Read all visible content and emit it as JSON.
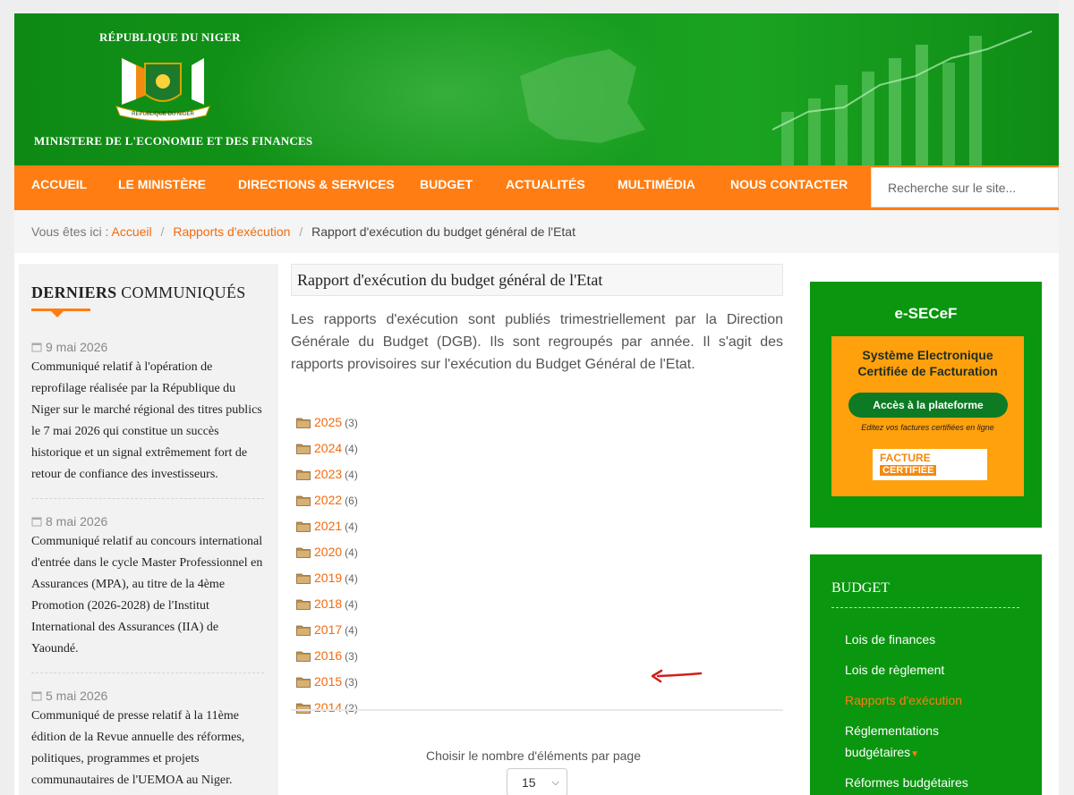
{
  "header": {
    "country": "RÉPUBLIQUE DU NIGER",
    "ministry": "MINISTERE DE L'ECONOMIE ET DES FINANCES",
    "emblem_text": "REPUBLIQUE DU NIGER"
  },
  "nav": {
    "items": [
      "ACCUEIL",
      "LE MINISTÈRE",
      "DIRECTIONS & SERVICES",
      "BUDGET",
      "ACTUALITÉS",
      "MULTIMÉDIA",
      "NOUS CONTACTER"
    ],
    "search_placeholder": "Recherche sur le site..."
  },
  "breadcrumb": {
    "prefix": "Vous êtes ici :",
    "home": "Accueil",
    "section": "Rapports d'exécution",
    "current": "Rapport d'exécution du budget général de l'Etat"
  },
  "communiques": {
    "title_bold": "DERNIERS",
    "title_rest": "COMMUNIQUÉS",
    "items": [
      {
        "date": "9 mai 2026",
        "text": "Communiqué relatif à l'opération de reprofilage réalisée par la République du Niger sur le marché régional des titres publics le 7 mai 2026 qui constitue un succès historique et un signal extrêmement fort de retour de confiance des investisseurs."
      },
      {
        "date": "8 mai 2026",
        "text": "Communiqué relatif au concours international d'entrée dans le cycle Master Professionnel en Assurances (MPA), au titre de la 4ème Promotion (2026-2028) de l'Institut International des Assurances (IIA) de Yaoundé."
      },
      {
        "date": "5 mai 2026",
        "text": "Communiqué de presse relatif à la 11ème édition de la Revue annuelle des réformes, politiques, programmes et projets communautaires de l'UEMOA au Niger."
      }
    ]
  },
  "main": {
    "title": "Rapport d'exécution du budget général de l'Etat",
    "intro": "Les rapports d'exécution sont publiés trimestriellement par la Direction Générale du Budget (DGB). Ils sont regroupés par année. Il s'agit des rapports provisoires sur l'exécution du Budget Général de l'Etat.",
    "categories": [
      {
        "year": "2025",
        "count": "(3)"
      },
      {
        "year": "2024",
        "count": "(4)"
      },
      {
        "year": "2023",
        "count": "(4)"
      },
      {
        "year": "2022",
        "count": "(6)"
      },
      {
        "year": "2021",
        "count": "(4)"
      },
      {
        "year": "2020",
        "count": "(4)"
      },
      {
        "year": "2019",
        "count": "(4)"
      },
      {
        "year": "2018",
        "count": "(4)"
      },
      {
        "year": "2017",
        "count": "(4)"
      },
      {
        "year": "2016",
        "count": "(3)"
      },
      {
        "year": "2015",
        "count": "(3)"
      },
      {
        "year": "2014",
        "count": "(2)"
      }
    ],
    "per_page_label": "Choisir le nombre d'éléments par page",
    "per_page_value": "15"
  },
  "esecef": {
    "title": "e-SECeF",
    "heading_line1": "Système Electronique",
    "heading_line2": "Certifiée de Facturation",
    "button": "Accès à la plateforme",
    "note": "Editez vos factures certifiées en ligne",
    "logo_line1": "FACTURE",
    "logo_line2": "CERTIFIÉE"
  },
  "budget_menu": {
    "title": "BUDGET",
    "items": [
      "Lois de finances",
      "Lois de règlement",
      "Rapports d'exécution",
      "Réglementations",
      "budgétaires",
      "Réformes budgétaires"
    ]
  },
  "colors": {
    "brand_green": "#0a960f",
    "brand_orange": "#ff7d12",
    "link_orange": "#f26b0f"
  }
}
